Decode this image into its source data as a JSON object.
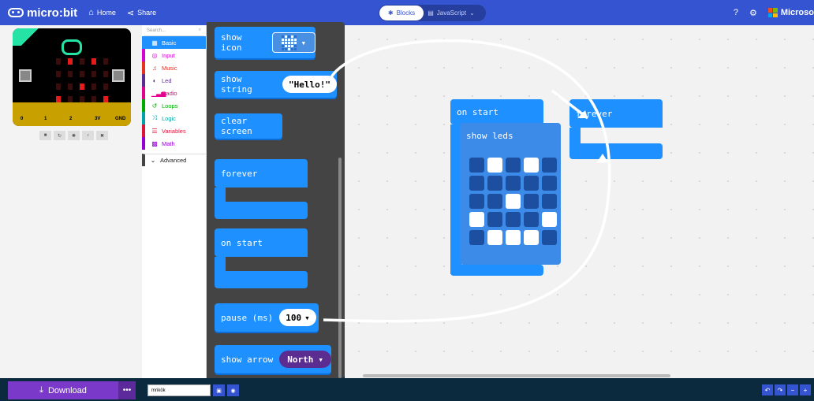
{
  "header": {
    "brand": "micro:bit",
    "home": "Home",
    "share": "Share",
    "tabs": [
      {
        "label": "Blocks",
        "active": true
      },
      {
        "label": "JavaScript",
        "active": false
      }
    ],
    "microsoft": "Microso"
  },
  "toolbox": {
    "search_placeholder": "Search...",
    "categories": [
      {
        "label": "Basic",
        "icon": "grid-icon",
        "color": "#1e90ff"
      },
      {
        "label": "Input",
        "icon": "target-icon",
        "color": "#d400d4"
      },
      {
        "label": "Music",
        "icon": "headphones-icon",
        "color": "#e63022"
      },
      {
        "label": "Led",
        "icon": "toggle-icon",
        "color": "#5c2d91"
      },
      {
        "label": "Radio",
        "icon": "signal-icon",
        "color": "#e3008c"
      },
      {
        "label": "Loops",
        "icon": "loop-icon",
        "color": "#00aa00"
      },
      {
        "label": "Logic",
        "icon": "shuffle-icon",
        "color": "#00a4a6"
      },
      {
        "label": "Variables",
        "icon": "list-icon",
        "color": "#dc143c"
      },
      {
        "label": "Math",
        "icon": "calculator-icon",
        "color": "#9400d3"
      }
    ],
    "advanced": "Advanced"
  },
  "flyout": {
    "show_icon": "show icon",
    "show_string": "show string",
    "show_string_value": "\"Hello!\"",
    "clear_screen": "clear screen",
    "forever": "forever",
    "on_start": "on start",
    "pause": "pause (ms)",
    "pause_value": "100",
    "show_arrow": "show arrow",
    "arrow_value": "North"
  },
  "workspace": {
    "on_start": "on start",
    "show_leds": "show leds",
    "forever": "forever",
    "led_pattern": [
      [
        0,
        1,
        0,
        1,
        0
      ],
      [
        0,
        0,
        0,
        0,
        0
      ],
      [
        0,
        0,
        1,
        0,
        0
      ],
      [
        1,
        0,
        0,
        0,
        1
      ],
      [
        0,
        1,
        1,
        1,
        0
      ]
    ]
  },
  "simulator": {
    "pins": [
      "0",
      "1",
      "2",
      "3V",
      "GND"
    ],
    "controls": [
      "stop-icon",
      "restart-icon",
      "debug-icon",
      "sound-icon",
      "fullscreen-icon"
    ]
  },
  "footer": {
    "download": "Download",
    "more": "•••",
    "project_name": "mrikök"
  }
}
